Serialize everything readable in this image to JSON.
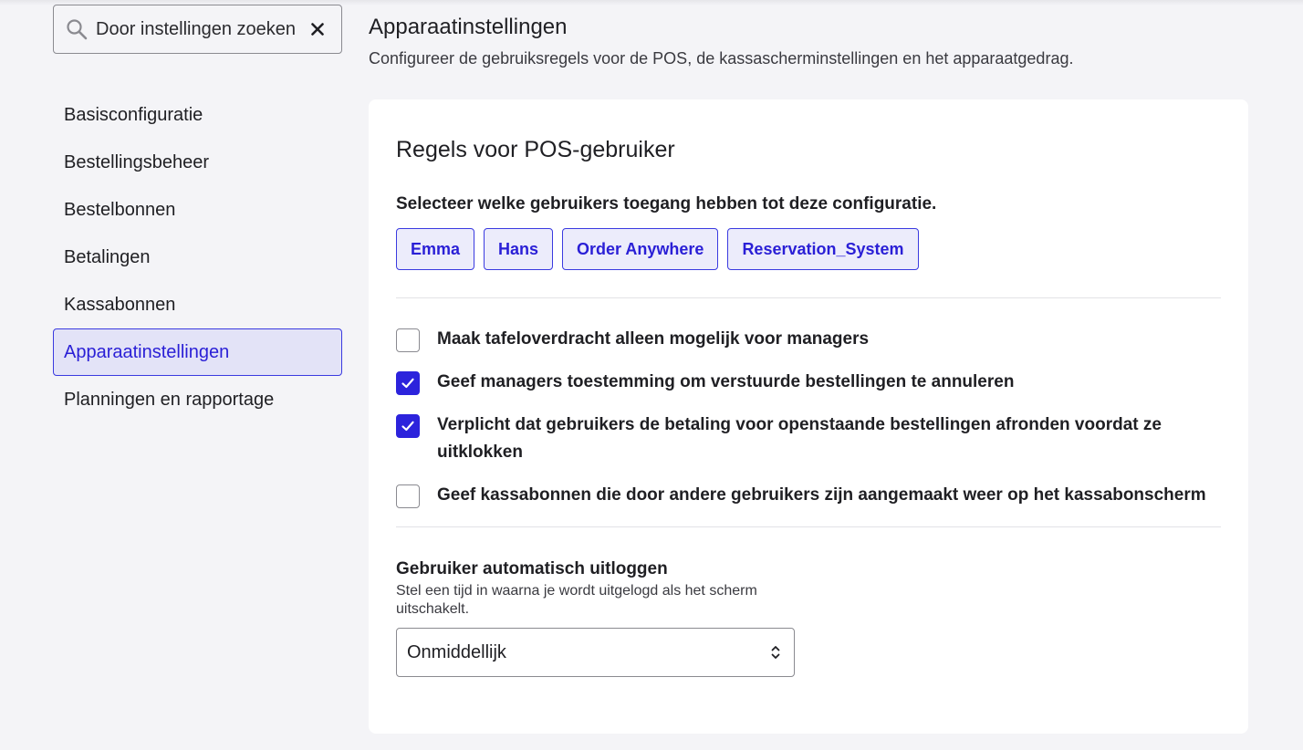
{
  "search": {
    "placeholder": "Door instellingen zoeken",
    "value": ""
  },
  "sidebar": {
    "items": [
      {
        "label": "Basisconfiguratie"
      },
      {
        "label": "Bestellingsbeheer"
      },
      {
        "label": "Bestelbonnen"
      },
      {
        "label": "Betalingen"
      },
      {
        "label": "Kassabonnen"
      },
      {
        "label": "Apparaatinstellingen",
        "active": true
      },
      {
        "label": "Planningen en rapportage"
      }
    ]
  },
  "page": {
    "title": "Apparaatinstellingen",
    "subtitle": "Configureer de gebruiksregels voor de POS, de kassascherminstellingen en het apparaatgedrag."
  },
  "card": {
    "title": "Regels voor POS-gebruiker",
    "users_label": "Selecteer welke gebruikers toegang hebben tot deze configuratie.",
    "users": [
      "Emma",
      "Hans",
      "Order Anywhere",
      "Reservation_System"
    ],
    "options": [
      {
        "label": "Maak tafeloverdracht alleen mogelijk voor managers",
        "checked": false
      },
      {
        "label": "Geef managers toestemming om verstuurde bestellingen te annuleren",
        "checked": true
      },
      {
        "label": "Verplicht dat gebruikers de betaling voor openstaande bestellingen afronden voordat ze uitklokken",
        "checked": true
      },
      {
        "label": "Geef kassabonnen die door andere gebruikers zijn aangemaakt weer op het kassabonscherm",
        "checked": false
      }
    ],
    "logout": {
      "title": "Gebruiker automatisch uitloggen",
      "description": "Stel een tijd in waarna je wordt uitgelogd als het scherm uitschakelt.",
      "selected": "Onmiddellijk"
    }
  },
  "colors": {
    "accent": "#2c23dc",
    "active_bg": "#e3e3f7",
    "page_bg": "#f4f4f7"
  },
  "icons": {
    "search": "search-icon",
    "clear": "close-icon",
    "check": "check-icon",
    "select": "chevron-up-down-icon"
  }
}
